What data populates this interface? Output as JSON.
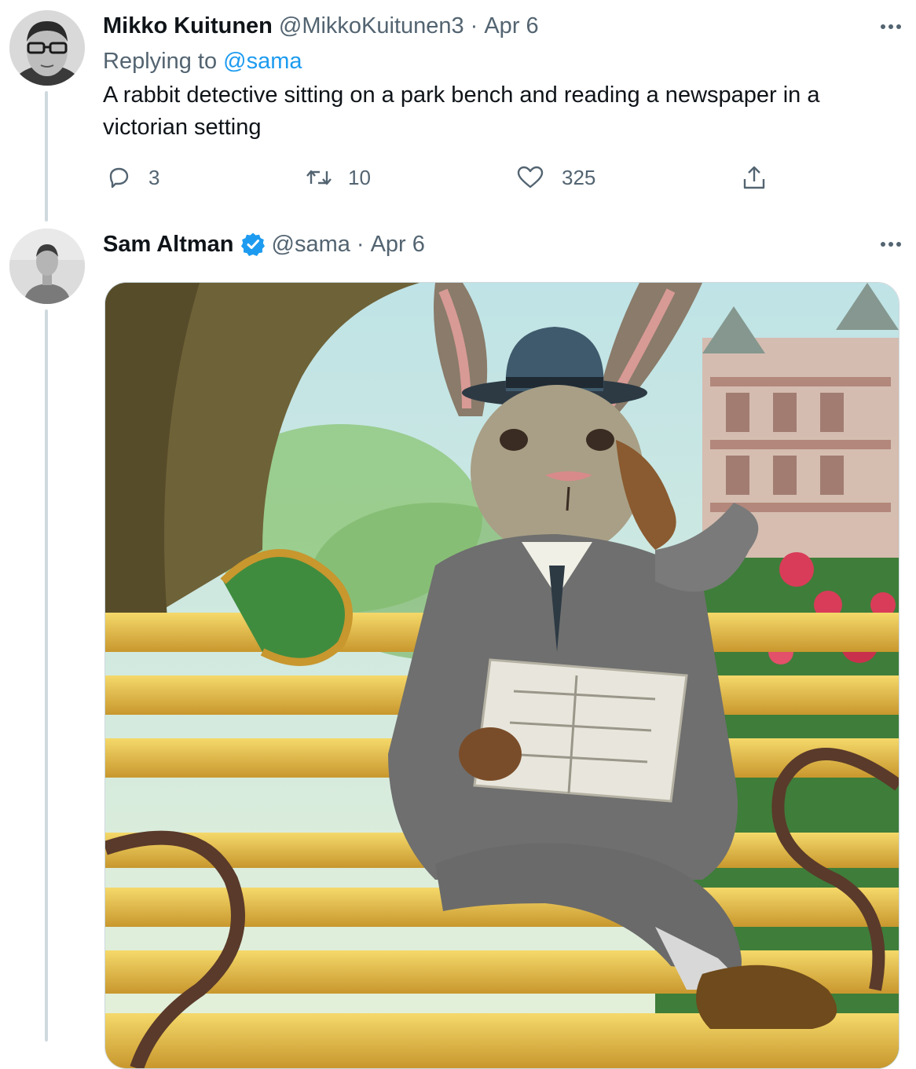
{
  "reply_tweet": {
    "author_name": "Mikko Kuitunen",
    "handle": "@MikkoKuitunen3",
    "separator": "·",
    "date": "Apr 6",
    "replying_label": "Replying to",
    "replying_to": "@sama",
    "text": "A rabbit detective sitting on a park bench and reading a newspaper in a victorian setting",
    "replies_count": "3",
    "retweets_count": "10",
    "likes_count": "325",
    "icons": [
      "reply-icon",
      "retweet-icon",
      "like-icon",
      "share-icon",
      "more-icon"
    ]
  },
  "main_tweet": {
    "author_name": "Sam Altman",
    "verified": true,
    "handle": "@sama",
    "separator": "·",
    "date": "Apr 6",
    "media_description": "rabbit detective illustration",
    "icons": [
      "verified-badge-icon",
      "more-icon"
    ]
  },
  "colors": {
    "text_primary": "#0f1419",
    "text_secondary": "#536471",
    "accent": "#1d9bf0",
    "thread_line": "#cfd9de"
  }
}
